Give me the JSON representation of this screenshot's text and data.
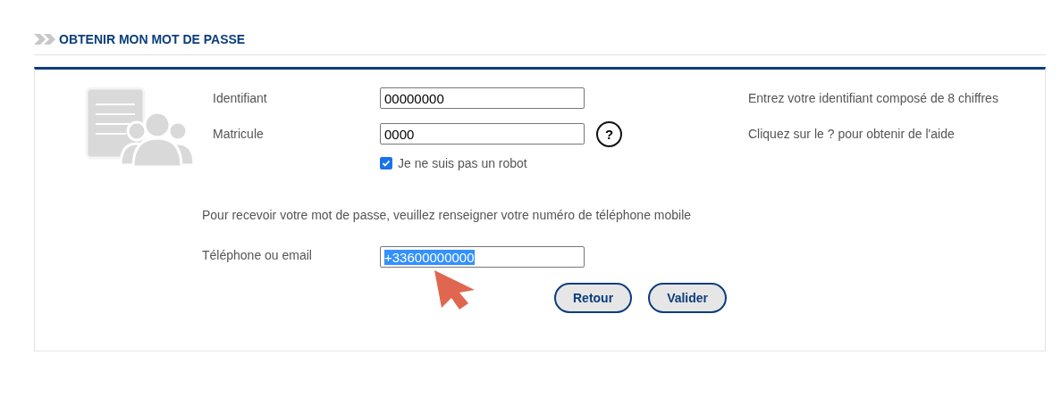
{
  "page_title": "OBTENIR MON MOT DE PASSE",
  "fields": [
    {
      "label": "Identifiant",
      "value": "00000000",
      "help_button": false,
      "hint": "Entrez votre identifiant composé de 8 chiffres"
    },
    {
      "label": "Matricule",
      "value": "0000",
      "help_button": true,
      "help_glyph": "?",
      "hint": "Cliquez sur le ? pour obtenir de l'aide"
    }
  ],
  "robot_check": {
    "label": "Je ne suis pas un robot",
    "checked": true
  },
  "instruction": "Pour recevoir votre mot de passe, veuillez renseigner votre numéro de téléphone mobile",
  "contact": {
    "label": "Téléphone ou email",
    "value": "+33600000000",
    "text_selected": true
  },
  "buttons": [
    "Retour",
    "Valider"
  ]
}
